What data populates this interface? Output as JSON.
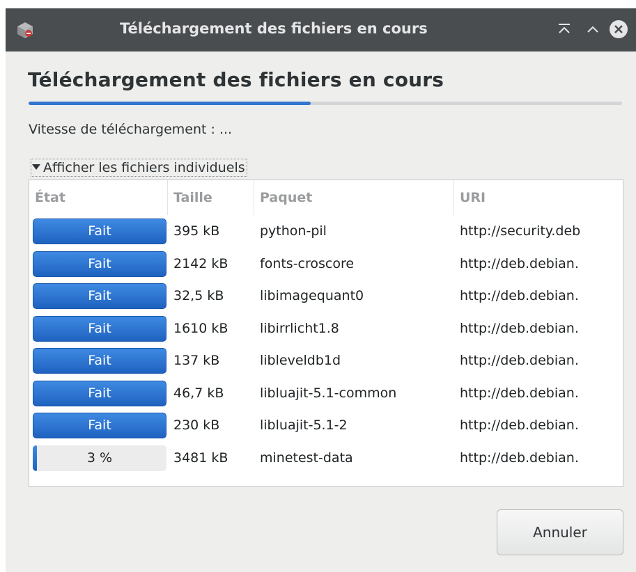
{
  "window": {
    "title": "Téléchargement des fichiers en cours",
    "buttons": [
      "keep-above",
      "maximize",
      "close"
    ]
  },
  "heading": "Téléchargement des fichiers en cours",
  "overall_progress": 0.475,
  "speed_label": "Vitesse de téléchargement : ...",
  "expander_label": "Afficher les fichiers individuels",
  "table": {
    "columns": [
      "État",
      "Taille",
      "Paquet",
      "URI"
    ],
    "rows": [
      {
        "status": "Fait",
        "progress": 1.0,
        "size": "395 kB",
        "package": "python-pil",
        "uri": "http://security.deb"
      },
      {
        "status": "Fait",
        "progress": 1.0,
        "size": "2142 kB",
        "package": "fonts-croscore",
        "uri": "http://deb.debian."
      },
      {
        "status": "Fait",
        "progress": 1.0,
        "size": "32,5 kB",
        "package": "libimagequant0",
        "uri": "http://deb.debian."
      },
      {
        "status": "Fait",
        "progress": 1.0,
        "size": "1610 kB",
        "package": "libirrlicht1.8",
        "uri": "http://deb.debian."
      },
      {
        "status": "Fait",
        "progress": 1.0,
        "size": "137 kB",
        "package": "libleveldb1d",
        "uri": "http://deb.debian."
      },
      {
        "status": "Fait",
        "progress": 1.0,
        "size": "46,7 kB",
        "package": "libluajit-5.1-common",
        "uri": "http://deb.debian."
      },
      {
        "status": "Fait",
        "progress": 1.0,
        "size": "230 kB",
        "package": "libluajit-5.1-2",
        "uri": "http://deb.debian."
      },
      {
        "status": "3 %",
        "progress": 0.03,
        "size": "3481 kB",
        "package": "minetest-data",
        "uri": "http://deb.debian."
      }
    ]
  },
  "cancel_label": "Annuler",
  "colors": {
    "titlebar": "#4a4d50",
    "accent": "#3076d2",
    "background": "#eeeeec"
  }
}
